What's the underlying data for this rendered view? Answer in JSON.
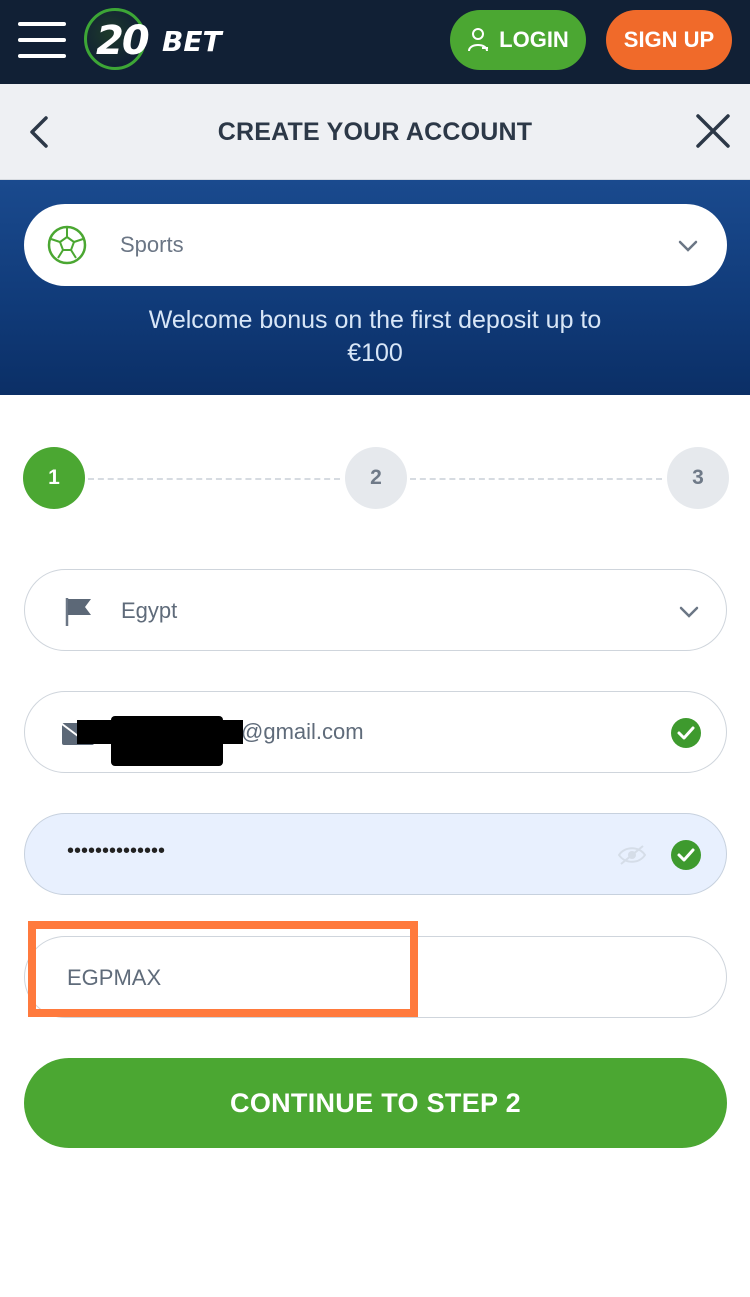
{
  "topbar": {
    "logo_number": "20",
    "logo_text": "BET",
    "login_label": "LOGIN",
    "signup_label": "SIGN UP"
  },
  "header": {
    "title": "CREATE YOUR ACCOUNT"
  },
  "banner": {
    "bonus_type": "Sports",
    "welcome_line1": "Welcome bonus on the first deposit up to",
    "welcome_line2": "€100"
  },
  "stepper": {
    "current": 1,
    "steps": [
      "1",
      "2",
      "3"
    ]
  },
  "form": {
    "country": "Egypt",
    "email_visible_part": "@gmail.com",
    "password_masked": "••••••••••••••",
    "promo_code": "EGPMAX",
    "continue_label": "CONTINUE TO STEP 2"
  },
  "colors": {
    "nav_bg": "#112035",
    "brand_green": "#4ba732",
    "signup_orange": "#f06a2a",
    "banner_blue": "#103a78",
    "highlight_orange": "#ff7a3d"
  },
  "icons": {
    "menu": "hamburger-icon",
    "login": "user-icon",
    "back": "chevron-left-icon",
    "close": "close-icon",
    "sports": "soccer-ball-icon",
    "country": "flag-icon",
    "email": "envelope-icon",
    "password_toggle": "eye-icon",
    "valid": "check-circle-icon"
  }
}
